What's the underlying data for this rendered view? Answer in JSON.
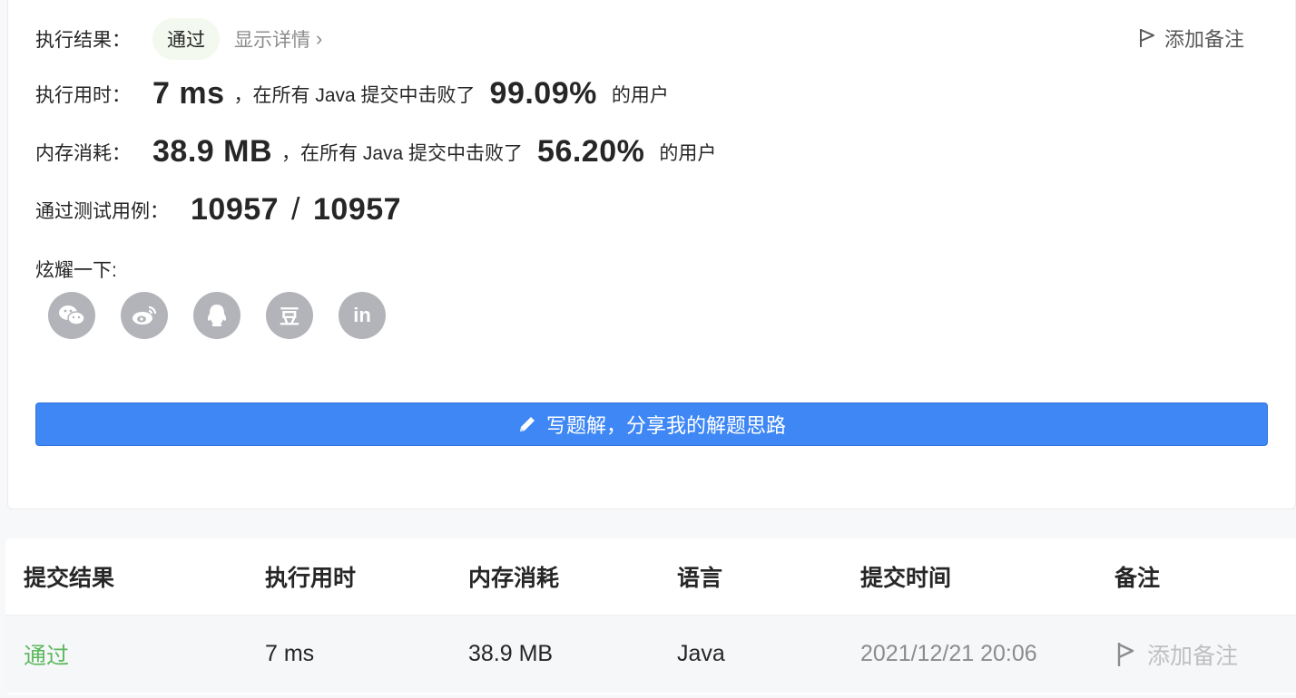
{
  "result": {
    "label": "执行结果：",
    "status": "通过",
    "details_link": "显示详情",
    "add_note": "添加备注"
  },
  "runtime": {
    "label": "执行用时：",
    "value": "7 ms",
    "text": "，在所有 Java 提交中击败了",
    "percent": "99.09%",
    "suffix": "的用户"
  },
  "memory": {
    "label": "内存消耗：",
    "value": "38.9 MB",
    "text": "，在所有 Java 提交中击败了",
    "percent": "56.20%",
    "suffix": "的用户"
  },
  "tests": {
    "label": "通过测试用例：",
    "passed": "10957",
    "separator": "/",
    "total": "10957"
  },
  "share": {
    "label": "炫耀一下:",
    "icons": [
      "wechat-icon",
      "weibo-icon",
      "qq-icon",
      "douban-icon",
      "linkedin-icon"
    ],
    "douban_glyph": "豆",
    "linkedin_glyph": "in"
  },
  "write_solution": "写题解，分享我的解题思路",
  "table": {
    "headers": [
      "提交结果",
      "执行用时",
      "内存消耗",
      "语言",
      "提交时间",
      "备注"
    ],
    "rows": [
      {
        "result": "通过",
        "runtime": "7 ms",
        "memory": "38.9 MB",
        "language": "Java",
        "time": "2021/12/21 20:06",
        "note": "添加备注"
      }
    ]
  },
  "colors": {
    "accent": "#3e87f5",
    "pass": "#5cb85c",
    "share_icon_bg": "#b2b4b9"
  }
}
